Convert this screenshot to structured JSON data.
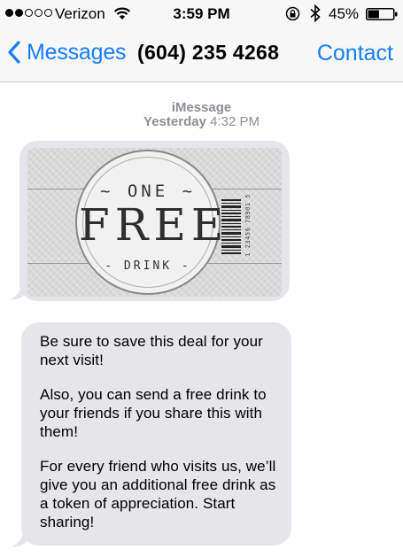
{
  "status_bar": {
    "carrier": "Verizon",
    "signal_bars_filled": 2,
    "signal_bars_total": 5,
    "time": "3:59 PM",
    "battery_percent": "45%",
    "icons": [
      "signal-dots-icon",
      "wifi-icon",
      "rotation-lock-icon",
      "bluetooth-icon",
      "battery-icon"
    ]
  },
  "nav": {
    "back_label": "Messages",
    "title": "(604) 235 4268",
    "contact_label": "Contact"
  },
  "conversation": {
    "service": "iMessage",
    "timestamp_day": "Yesterday",
    "timestamp_time": "4:32 PM",
    "coupon": {
      "top_text": "~ ONE ~",
      "big_text": "FREE",
      "bottom_text": "- DRINK -",
      "barcode_number": "1 23456 78901 5"
    },
    "message_paragraphs": [
      "Be sure to save this deal for your next visit!",
      "Also, you can send a free drink to your friends if you share this with them!",
      "For every friend who visits us, we’ll give you an additional free drink as a token of appreciation. Start sharing!"
    ]
  },
  "colors": {
    "accent": "#147efb",
    "bubble": "#e5e5ea",
    "secondary_text": "#8e8e93",
    "header_bg": "#f7f7f8"
  }
}
